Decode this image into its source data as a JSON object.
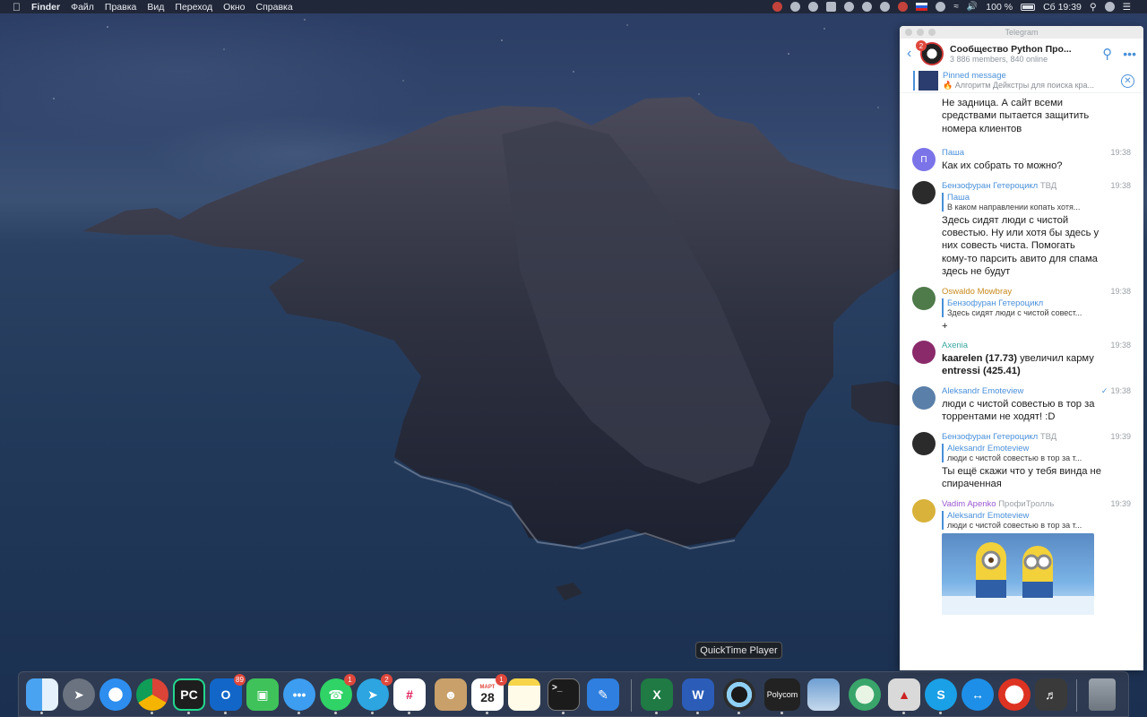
{
  "menubar": {
    "app_name": "Finder",
    "menus": [
      "Файл",
      "Правка",
      "Вид",
      "Переход",
      "Окно",
      "Справка"
    ],
    "battery": "100 %",
    "clock": "Сб 19:39"
  },
  "telegram": {
    "window_title": "Telegram",
    "back_badge": "2",
    "chat_name": "Сообщество Python Про...",
    "chat_status": "3 886 members, 840 online",
    "pinned": {
      "title": "Pinned message",
      "text": "🔥 Алгоритм Дейкстры для поиска кра..."
    },
    "first_text_lines": "Не задница. А сайт всеми средствами пытается защитить номера клиентов",
    "messages": [
      {
        "name": "Паша",
        "role": "",
        "time": "19:38",
        "avatar_letter": "П",
        "text": "Как их собрать то можно?"
      },
      {
        "name": "Бензофуран Гетероцикл",
        "role": "ТВД",
        "time": "19:38",
        "reply_name": "Паша",
        "reply_text": "В каком направлении копать хотя...",
        "text": "Здесь сидят люди с чистой совестью. Ну или хотя бы здесь у них совесть чиста. Помогать кому-то парсить авито для спама здесь не будут"
      },
      {
        "name": "Oswaldo Mowbray",
        "role": "",
        "time": "19:38",
        "reply_name": "Бензофуран Гетероцикл",
        "reply_text": "Здесь сидят люди с чистой совест...",
        "text": "+"
      },
      {
        "name": "Axenia",
        "role": "",
        "time": "19:38",
        "text_bold1": "kaarelen (17.73)",
        "text_mid": " увеличил карму ",
        "text_bold2": "entressi (425.41)"
      },
      {
        "name": "Aleksandr Emoteview",
        "role": "",
        "time": "19:38",
        "text": "люди с чистой совестью в тор за торрентами не ходят! :D"
      },
      {
        "name": "Бензофуран Гетероцикл",
        "role": "ТВД",
        "time": "19:39",
        "reply_name": "Aleksandr Emoteview",
        "reply_text": "люди с чистой совестью в тор за т...",
        "text": "Ты ещё скажи что у тебя винда не спираченная"
      },
      {
        "name": "Vadim Apenko",
        "role": "ПрофиТролль",
        "time": "19:39",
        "reply_name": "Aleksandr Emoteview",
        "reply_text": "люди с чистой совестью в тор за т..."
      }
    ]
  },
  "dock": {
    "tooltip": "QuickTime Player",
    "calendar_month": "МАРТ",
    "calendar_day": "28",
    "polycom_label": "Polycom",
    "badges": {
      "outlook": "89",
      "whatsapp": "1",
      "telegram": "2",
      "calendar": "1"
    }
  }
}
